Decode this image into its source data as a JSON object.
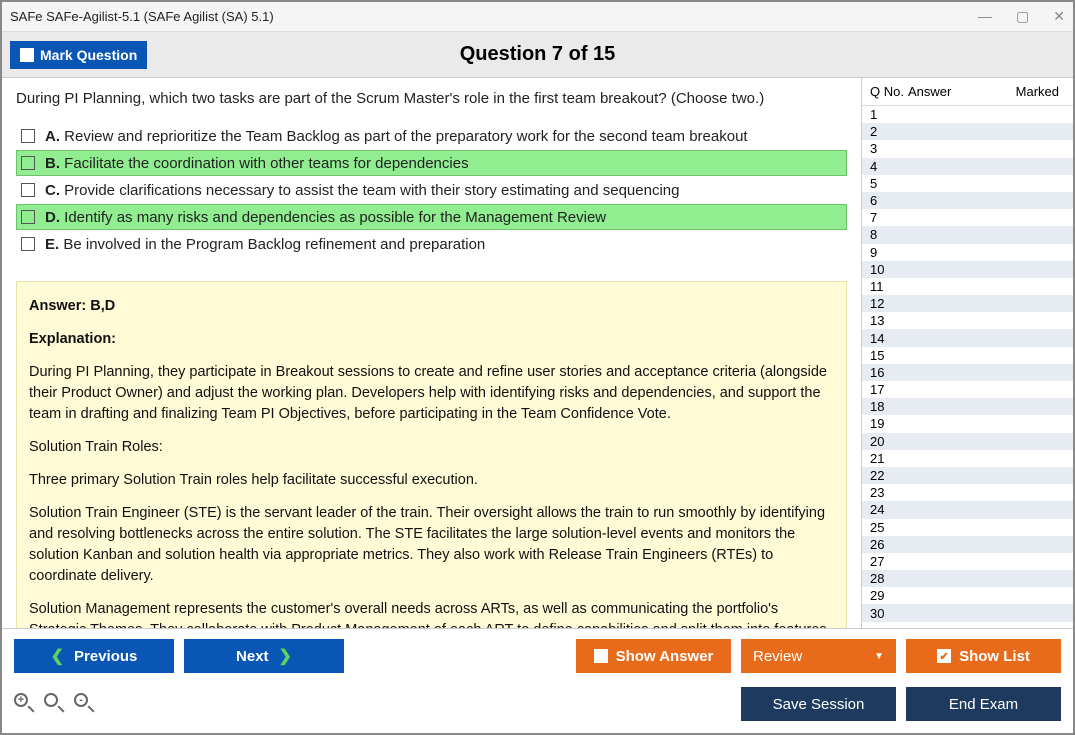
{
  "window": {
    "title": "SAFe SAFe-Agilist-5.1 (SAFe Agilist (SA) 5.1)"
  },
  "header": {
    "mark_label": "Mark Question",
    "question_title": "Question 7 of 15"
  },
  "question": {
    "stem": "During PI Planning, which two tasks are part of the Scrum Master's role in the first team breakout? (Choose two.)",
    "options": [
      {
        "letter": "A.",
        "text": "Review and reprioritize the Team Backlog as part of the preparatory work for the second team breakout",
        "correct": false
      },
      {
        "letter": "B.",
        "text": "Facilitate the coordination with other teams for dependencies",
        "correct": true
      },
      {
        "letter": "C.",
        "text": "Provide clarifications necessary to assist the team with their story estimating and sequencing",
        "correct": false
      },
      {
        "letter": "D.",
        "text": "Identify as many risks and dependencies as possible for the Management Review",
        "correct": true
      },
      {
        "letter": "E.",
        "text": "Be involved in the Program Backlog refinement and preparation",
        "correct": false
      }
    ]
  },
  "explanation": {
    "answer_label": "Answer: B,D",
    "exp_label": "Explanation:",
    "p1": "During PI Planning, they participate in Breakout sessions to create and refine user stories and acceptance criteria (alongside their Product Owner) and adjust the working plan. Developers help with identifying risks and dependencies, and support the team in drafting and finalizing Team PI Objectives, before participating in the Team Confidence Vote.",
    "p2": "Solution Train Roles:",
    "p3": "Three primary Solution Train roles help facilitate successful execution.",
    "p4": "Solution Train Engineer (STE) is the servant leader of the train. Their oversight allows the train to run smoothly by identifying and resolving bottlenecks across the entire solution. The STE facilitates the large solution-level events and monitors the solution Kanban and solution health via appropriate metrics. They also work with Release Train Engineers (RTEs) to coordinate delivery.",
    "p5": "Solution Management represents the customer's overall needs across ARTs, as well as communicating the portfolio's Strategic Themes. They collaborate with Product Management of each ART to define capabilities and split them into features. Solution Management, the primary content authority for the solution backlog, also contributes to the economic"
  },
  "list": {
    "h1": "Q No.",
    "h2": "Answer",
    "h3": "Marked",
    "count": 30
  },
  "footer": {
    "previous": "Previous",
    "next": "Next",
    "show_answer": "Show Answer",
    "review": "Review",
    "show_list": "Show List",
    "save_session": "Save Session",
    "end_exam": "End Exam"
  }
}
